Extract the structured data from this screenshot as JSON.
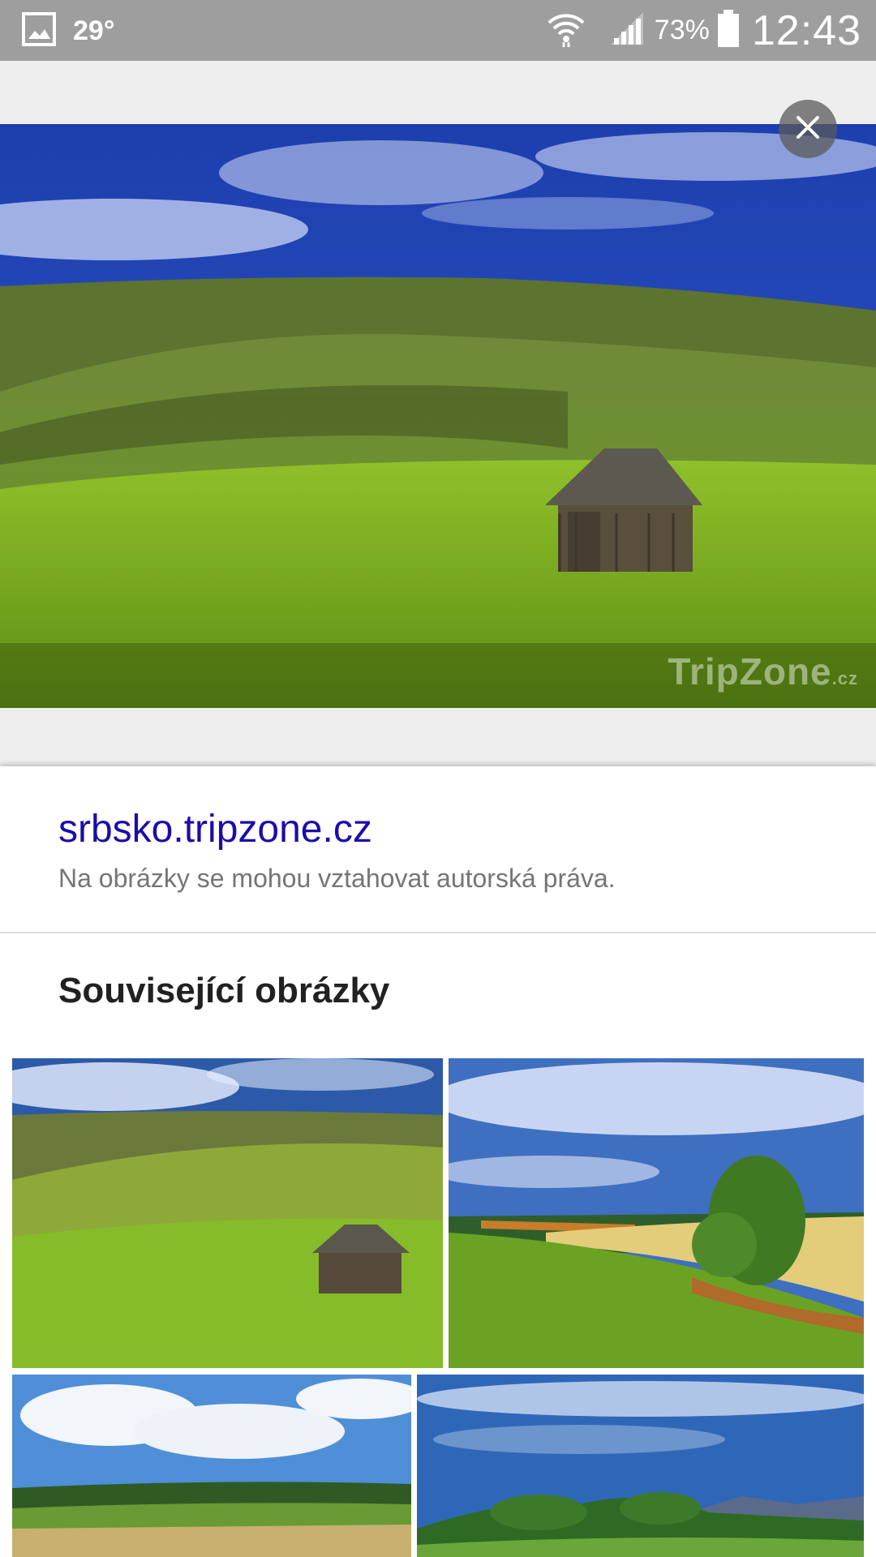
{
  "status_bar": {
    "temperature": "29°",
    "battery_percent": "73%",
    "time": "12:43",
    "icons": [
      "gallery-icon",
      "wifi-icon",
      "signal-icon",
      "battery-icon"
    ]
  },
  "viewer": {
    "watermark": "TripZone",
    "watermark_suffix": ".cz",
    "close_icon": "close-icon"
  },
  "info": {
    "source_domain": "srbsko.tripzone.cz",
    "copyright_note": "Na obrázky se mohou vztahovat autorská práva."
  },
  "related": {
    "title": "Související obrázky"
  },
  "colors": {
    "link": "#1a0dab",
    "status_bar": "#9e9e9e",
    "viewer_bg": "#eeeeee"
  }
}
